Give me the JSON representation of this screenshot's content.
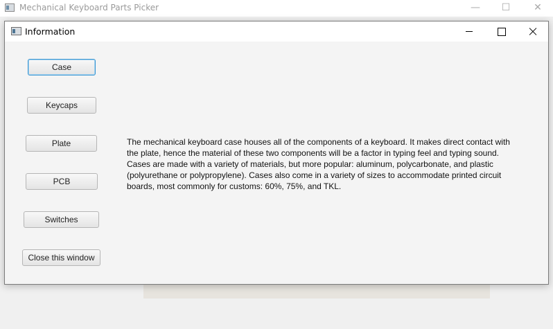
{
  "main_window": {
    "title": "Mechanical Keyboard Parts Picker",
    "controls": {
      "minimize": "—",
      "maximize": "☐",
      "close": "✕"
    }
  },
  "dialog": {
    "title": "Information",
    "buttons": [
      {
        "label": "Case",
        "focused": true
      },
      {
        "label": "Keycaps"
      },
      {
        "label": "Plate"
      },
      {
        "label": "PCB"
      },
      {
        "label": "Switches"
      },
      {
        "label": "Close this window"
      }
    ],
    "info_text": "The mechanical keyboard case houses all of the components of a keyboard. It makes direct contact with the plate, hence the material of these two components will be a factor in typing feel and typing sound. Cases are made with a variety of materials, but more popular: aluminum, polycarbonate, and plastic (polyurethane or polypropylene). Cases also come in a variety of sizes to accommodate printed circuit boards, most commonly for customs: 60%, 75%, and TKL."
  },
  "colors": {
    "focus_border": "#3b97d3",
    "dialog_bg": "#f4f4f4",
    "titlebar_bg": "#ffffff"
  }
}
